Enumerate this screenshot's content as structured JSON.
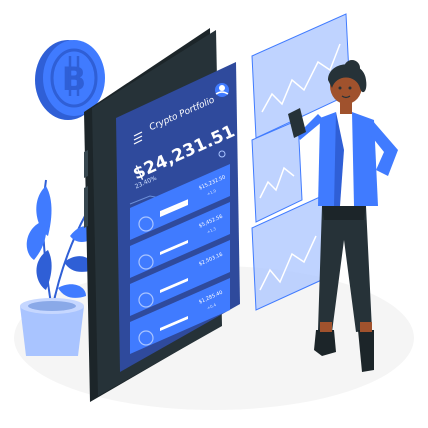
{
  "app": {
    "title": "Crypto Portfolio",
    "balance": "$24,231.51",
    "change": "23.40%"
  },
  "holdings": [
    {
      "icon": "bitcoin-icon",
      "amount": "$15,232.50",
      "change": "+1.9"
    },
    {
      "icon": "ethereum-icon",
      "amount": "$5,452.56",
      "change": "+1.3"
    },
    {
      "icon": "coin-icon",
      "amount": "$2,503.16",
      "change": ""
    },
    {
      "icon": "litecoin-icon",
      "amount": "$1,285.40",
      "change": "+0.4"
    }
  ],
  "colors": {
    "accent": "#407bff",
    "accent_light": "#a9c4ff",
    "phone_frame": "#263238",
    "screen": "#2f4a9c",
    "jacket": "#407bff",
    "trousers": "#263238",
    "skin": "#a0522d"
  }
}
